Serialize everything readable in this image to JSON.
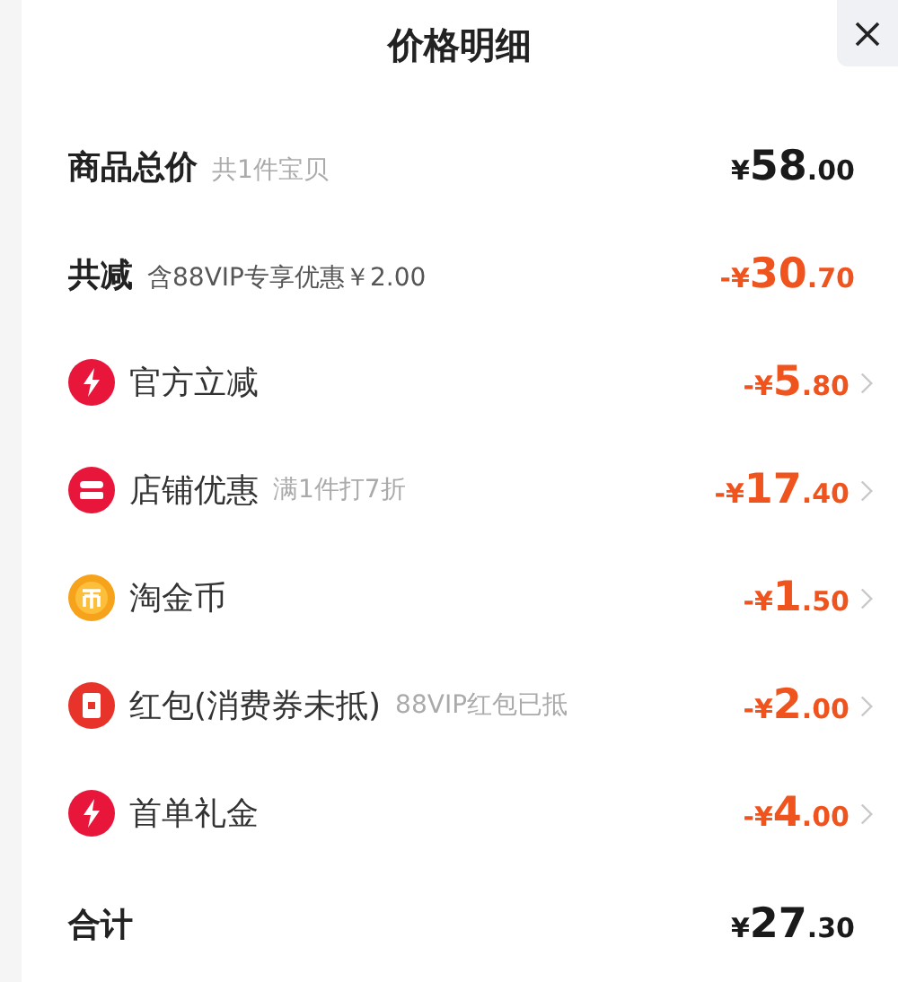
{
  "title": "价格明细",
  "summary": [
    {
      "label": "商品总价",
      "note": "共1件宝贝",
      "amount": {
        "sign": "¥",
        "whole": "58",
        "cents": ".00"
      },
      "kind": "price"
    },
    {
      "label": "共减",
      "note": "含88VIP专享优惠￥2.00",
      "amount": {
        "sign": "-¥",
        "whole": "30",
        "cents": ".70"
      },
      "kind": "discount"
    }
  ],
  "items": [
    {
      "kind": "bolt",
      "label": "官方立减",
      "amount": {
        "sign": "-¥",
        "whole": "5",
        "cents": ".80"
      }
    },
    {
      "kind": "shop",
      "label": "店铺优惠",
      "note": "满1件打7折",
      "amount": {
        "sign": "-¥",
        "whole": "17",
        "cents": ".40"
      }
    },
    {
      "kind": "coin",
      "label": "淘金币",
      "amount": {
        "sign": "-¥",
        "whole": "1",
        "cents": ".50"
      }
    },
    {
      "kind": "redpacket",
      "label": "红包(消费券未抵)",
      "note": "88VIP红包已抵",
      "amount": {
        "sign": "-¥",
        "whole": "2",
        "cents": ".00"
      }
    },
    {
      "kind": "bolt",
      "label": "首单礼金",
      "amount": {
        "sign": "-¥",
        "whole": "4",
        "cents": ".00"
      }
    }
  ],
  "total": {
    "label": "合计",
    "amount": {
      "sign": "¥",
      "whole": "27",
      "cents": ".30"
    }
  }
}
